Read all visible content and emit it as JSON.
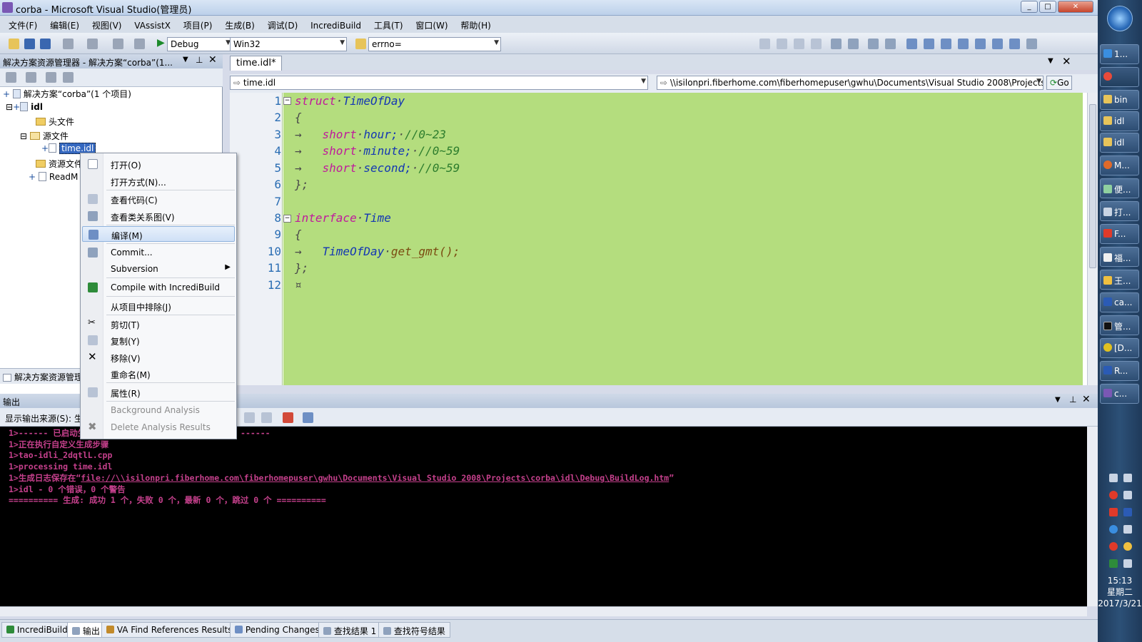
{
  "window": {
    "title": "corba - Microsoft Visual Studio(管理员)"
  },
  "menu": [
    "文件(F)",
    "编辑(E)",
    "视图(V)",
    "VAssistX",
    "项目(P)",
    "生成(B)",
    "调试(D)",
    "IncrediBuild",
    "工具(T)",
    "窗口(W)",
    "帮助(H)"
  ],
  "toolbar": {
    "config": "Debug",
    "platform": "Win32",
    "find_value": "errno="
  },
  "solution_explorer": {
    "header": "解决方案资源管理器 - 解决方案“corba”(1...",
    "tree": [
      {
        "label": "解决方案“corba”(1 个项目)"
      },
      {
        "label": "idl"
      },
      {
        "label": "头文件"
      },
      {
        "label": "源文件"
      },
      {
        "label": "time.idl"
      },
      {
        "label": "资源文件"
      },
      {
        "label": "ReadM"
      }
    ],
    "bottom_tab": "解决方案资源管理器"
  },
  "editor": {
    "tab": "time.idl*",
    "nav_left": "time.idl",
    "nav_right": "\\\\isilonpri.fiberhome.com\\fiberhomepuser\\gwhu\\Documents\\Visual Studio 2008\\Projects",
    "go_label": "Go",
    "line_numbers": [
      "1",
      "2",
      "3",
      "4",
      "5",
      "6",
      "7",
      "8",
      "9",
      "10",
      "11",
      "12"
    ],
    "code": {
      "l1_kw": "struct",
      "l1_ty": "TimeOfDay",
      "l2": "{",
      "l3_kw": "short",
      "l3_id": "hour;",
      "l3_cm": "//0~23",
      "l4_kw": "short",
      "l4_id": "minute;",
      "l4_cm": "//0~59",
      "l5_kw": "short",
      "l5_id": "second;",
      "l5_cm": "//0~59",
      "l6": "};",
      "l8_kw": "interface",
      "l8_ty": "Time",
      "l9": "{",
      "l10_ty": "TimeOfDay",
      "l10_fn": "get_gmt();",
      "l11": "};"
    }
  },
  "context_menu": [
    {
      "label": "打开(O)"
    },
    {
      "label": "打开方式(N)..."
    },
    {
      "label": "查看代码(C)"
    },
    {
      "label": "查看类关系图(V)"
    },
    {
      "label": "编译(M)"
    },
    {
      "label": "Commit..."
    },
    {
      "label": "Subversion"
    },
    {
      "label": "Compile with IncrediBuild"
    },
    {
      "label": "从项目中排除(J)"
    },
    {
      "label": "剪切(T)"
    },
    {
      "label": "复制(Y)"
    },
    {
      "label": "移除(V)"
    },
    {
      "label": "重命名(M)"
    },
    {
      "label": "属性(R)"
    },
    {
      "label": "Background Analysis"
    },
    {
      "label": "Delete Analysis Results"
    }
  ],
  "output": {
    "header": "输出",
    "source_label": "显示输出来源(S):",
    "source_value": "生",
    "lines": [
      "1>------ 已启动生成: 项目: idl, 配置: Debug Win32 ------",
      "1>正在执行自定义生成步骤",
      "1>tao-idli_2dqtlL.cpp",
      "1>processing time.idl",
      "1>生成日志保存在“",
      "file://\\\\isilonpri.fiberhome.com\\fiberhomepuser\\gwhu\\Documents\\Visual Studio 2008\\Projects\\corba\\idl\\Debug\\BuildLog.htm",
      "”",
      "1>idl - 0 个错误，0 个警告",
      "========== 生成: 成功 1 个，失败 0 个，最新 0 个，跳过 0 个 =========="
    ]
  },
  "bottom_tabs": [
    "IncrediBuild",
    "输出",
    "VA Find References Results",
    "Pending Changes",
    "查找结果 1",
    "查找符号结果"
  ],
  "taskbar": {
    "items": [
      "1...",
      "bin",
      "idl",
      "idl",
      "M...",
      "便...",
      "打...",
      "F...",
      "福...",
      "王...",
      "ca...",
      "管...",
      "[D...",
      "R...",
      "c..."
    ],
    "time": "15:13",
    "weekday": "星期二",
    "date": "2017/3/21"
  }
}
